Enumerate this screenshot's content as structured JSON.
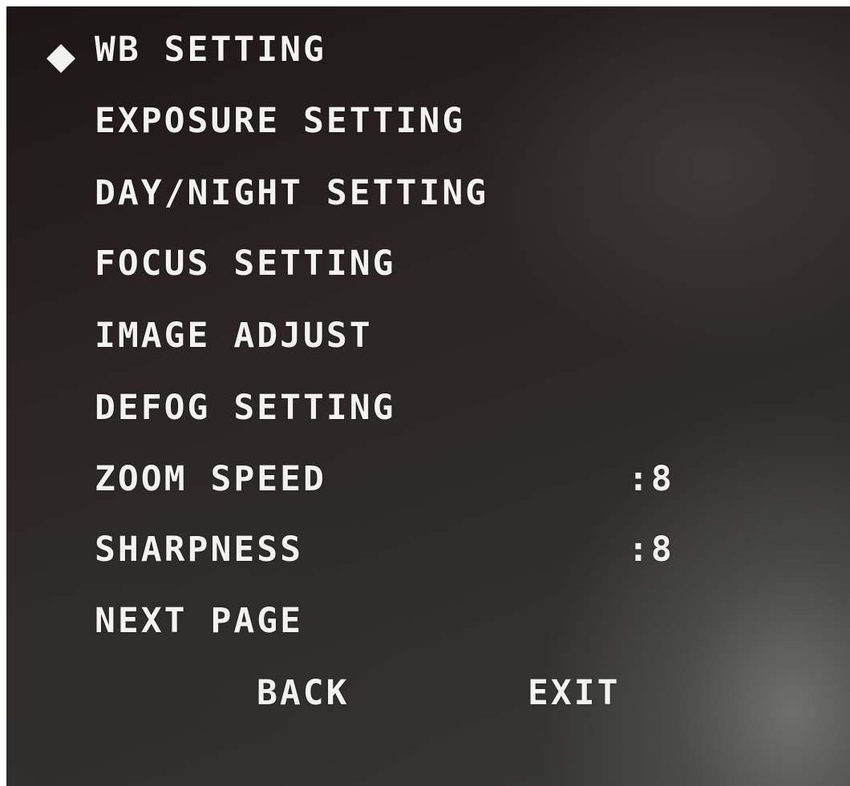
{
  "menu": {
    "cursor_icon": "diamond-selector-icon",
    "items": [
      {
        "label": "WB SETTING",
        "value": ""
      },
      {
        "label": "EXPOSURE SETTING",
        "value": ""
      },
      {
        "label": "DAY/NIGHT SETTING",
        "value": ""
      },
      {
        "label": "FOCUS SETTING",
        "value": ""
      },
      {
        "label": "IMAGE ADJUST",
        "value": ""
      },
      {
        "label": "DEFOG SETTING",
        "value": ""
      },
      {
        "label": "ZOOM SPEED",
        "value": ":8"
      },
      {
        "label": "SHARPNESS",
        "value": ":8"
      },
      {
        "label": "NEXT PAGE",
        "value": ""
      }
    ],
    "selected_index": 0
  },
  "footer": {
    "back_label": "BACK",
    "exit_label": "EXIT"
  },
  "colors": {
    "text": "#f2f2f0"
  }
}
